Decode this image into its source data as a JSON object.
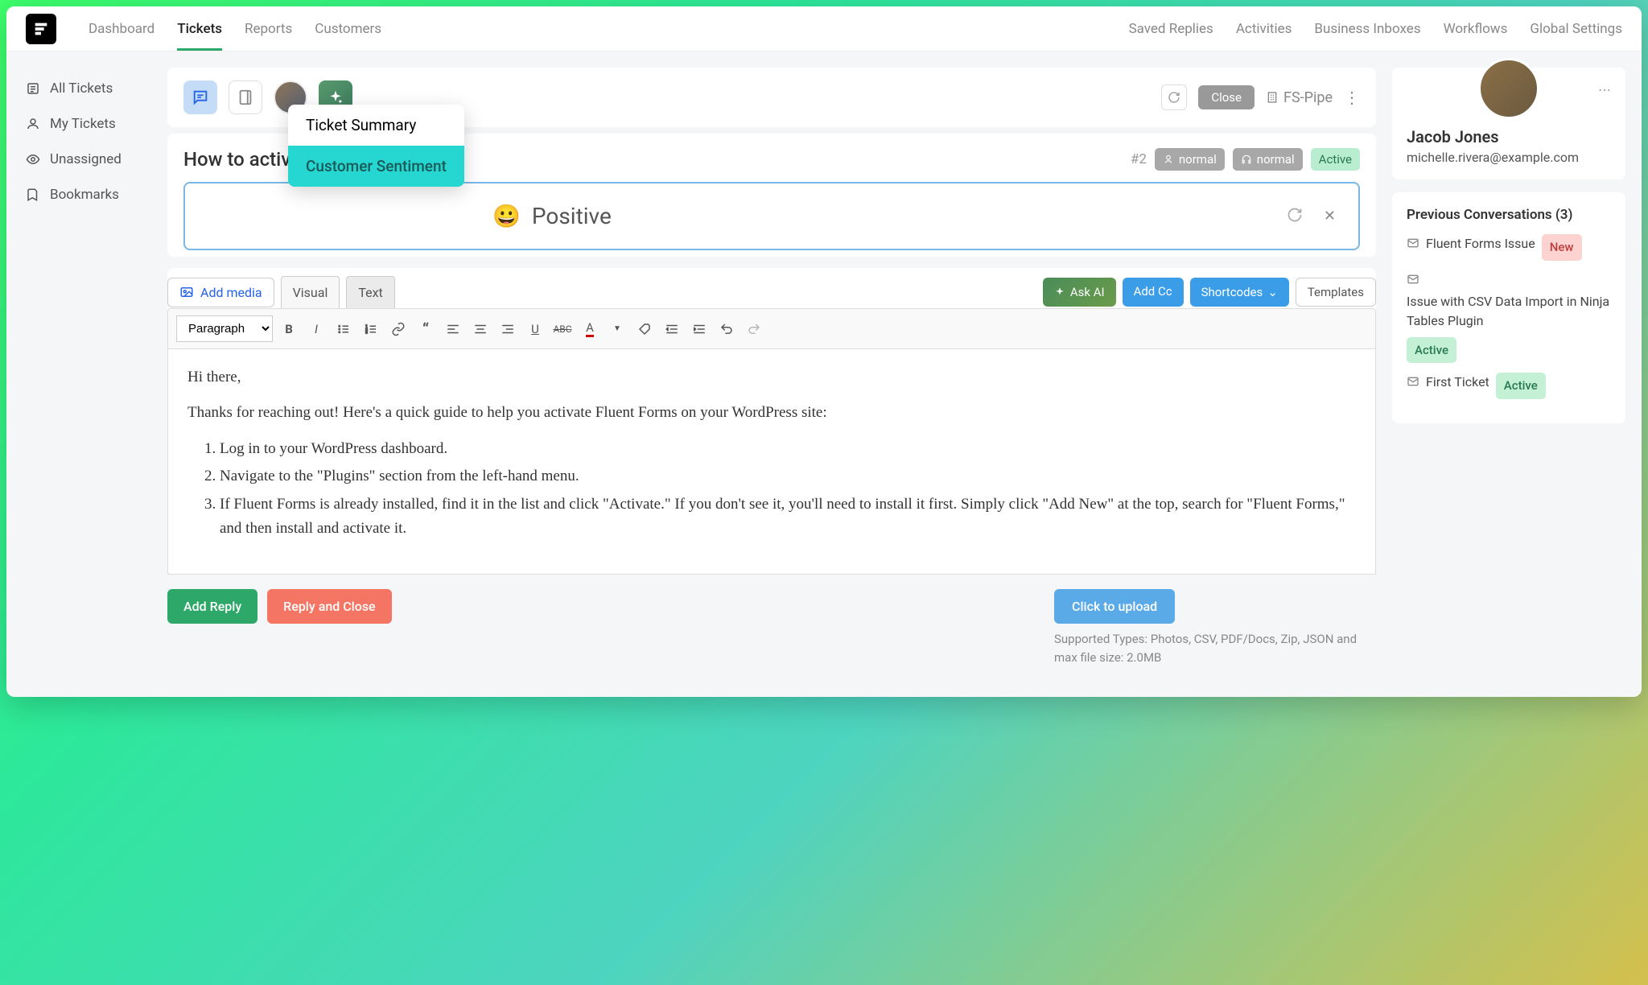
{
  "nav": {
    "left": [
      "Dashboard",
      "Tickets",
      "Reports",
      "Customers"
    ],
    "right": [
      "Saved Replies",
      "Activities",
      "Business Inboxes",
      "Workflows",
      "Global Settings"
    ],
    "activeIndex": 1
  },
  "sidebar": {
    "items": [
      {
        "label": "All Tickets",
        "icon": "list"
      },
      {
        "label": "My Tickets",
        "icon": "user"
      },
      {
        "label": "Unassigned",
        "icon": "eye"
      },
      {
        "label": "Bookmarks",
        "icon": "bookmark"
      }
    ]
  },
  "ticketHeader": {
    "closeLabel": "Close",
    "pipeLabel": "FS-Pipe"
  },
  "ticket": {
    "title": "How to activat",
    "number": "#2",
    "priority": "normal",
    "channel": "normal",
    "status": "Active"
  },
  "aiPopover": {
    "item1": "Ticket Summary",
    "item2": "Customer Sentiment"
  },
  "sentiment": {
    "emoji": "😀",
    "text": "Positive"
  },
  "editor": {
    "addMedia": "Add media",
    "tabVisual": "Visual",
    "tabText": "Text",
    "askAI": "Ask AI",
    "addCc": "Add Cc",
    "shortcodes": "Shortcodes",
    "templates": "Templates",
    "formatSelect": "Paragraph",
    "content": {
      "greeting": "Hi there,",
      "intro": "Thanks for reaching out! Here's a quick guide to help you activate Fluent Forms on your WordPress site:",
      "steps": [
        "Log in to your WordPress dashboard.",
        "Navigate to the \"Plugins\" section from the left-hand menu.",
        "If Fluent Forms is already installed, find it in the list and click \"Activate.\" If you don't see it, you'll need to install it first. Simply click \"Add New\" at the top, search for \"Fluent Forms,\" and then install and activate it."
      ]
    }
  },
  "actions": {
    "addReply": "Add Reply",
    "replyClose": "Reply and Close",
    "upload": "Click to upload",
    "hint": "Supported Types: Photos, CSV, PDF/Docs, Zip, JSON and max file size: 2.0MB"
  },
  "customer": {
    "name": "Jacob Jones",
    "email": "michelle.rivera@example.com"
  },
  "prevConvos": {
    "title": "Previous Conversations (3)",
    "items": [
      {
        "title": "Fluent Forms Issue",
        "badge": "New",
        "badgeType": "new"
      },
      {
        "title": "Issue with CSV Data Import in Ninja Tables Plugin",
        "badge": "Active",
        "badgeType": "green-active"
      },
      {
        "title": "First Ticket",
        "badge": "Active",
        "badgeType": "green-active"
      }
    ]
  }
}
